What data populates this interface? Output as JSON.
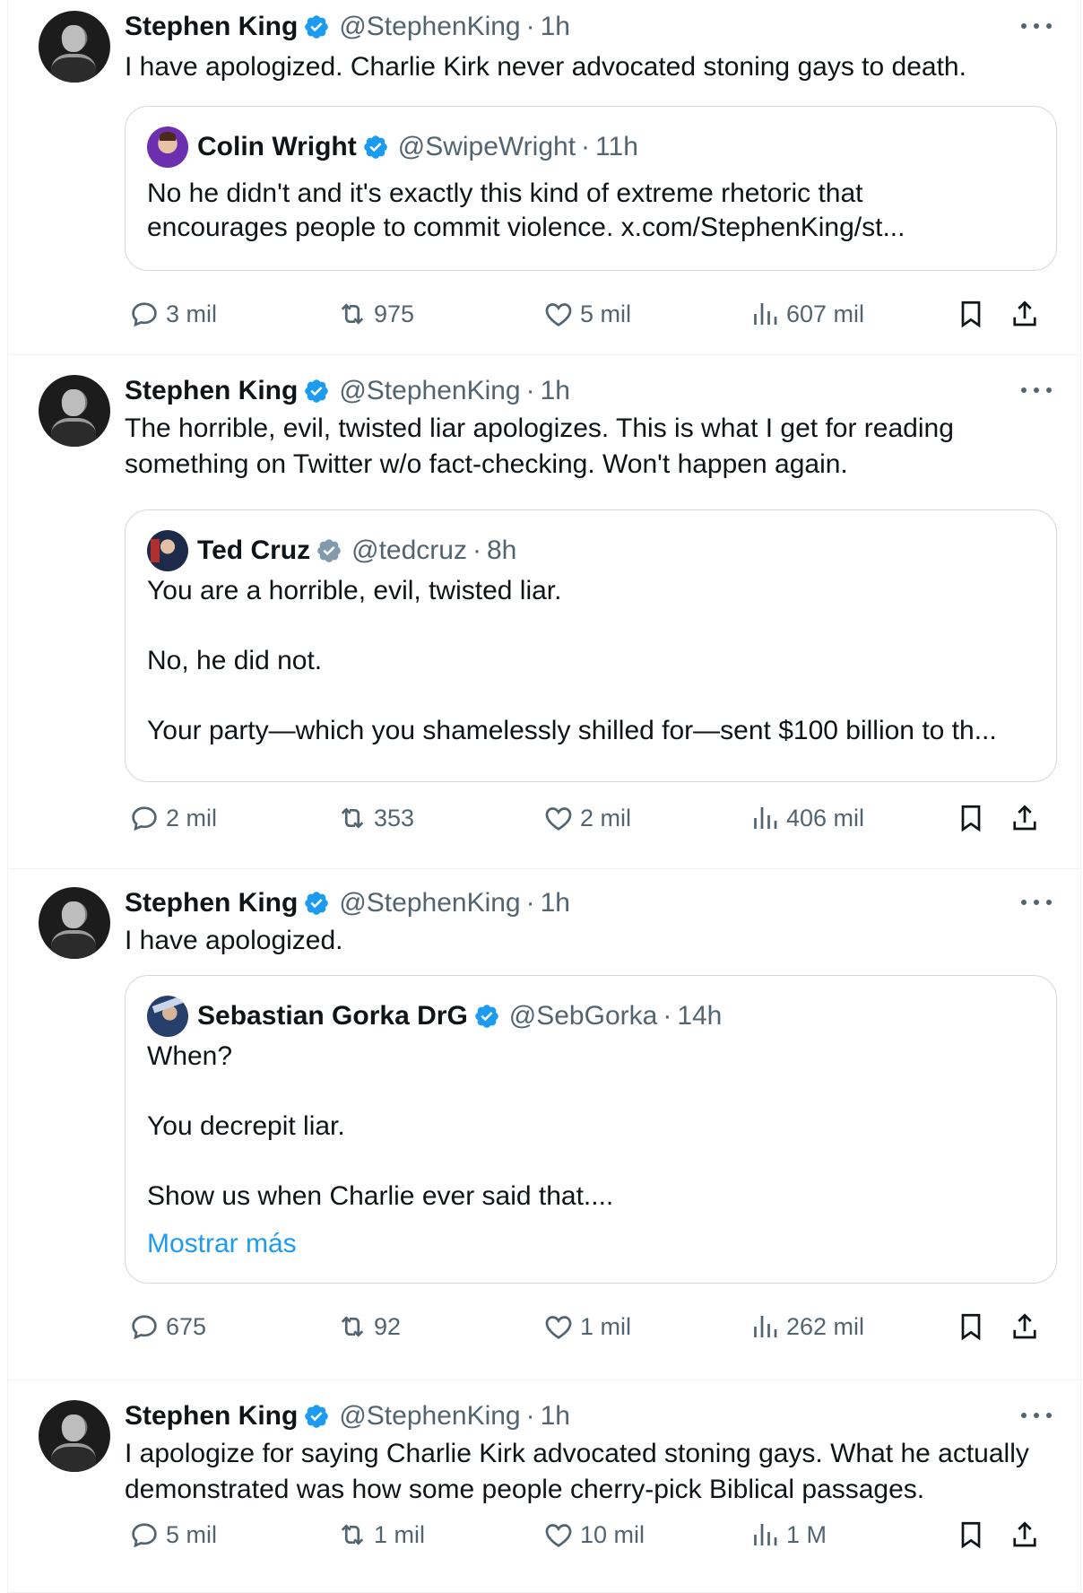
{
  "colors": {
    "verified": "#1d9bf0",
    "link": "#1d9bf0",
    "muted": "#536471",
    "text": "#0f1419"
  },
  "icons": [
    "verified-badge-icon",
    "more-icon",
    "reply-icon",
    "retweet-icon",
    "like-icon",
    "views-icon",
    "bookmark-icon",
    "share-icon"
  ],
  "tweets": [
    {
      "name": "Stephen King",
      "handle": "@StephenKing",
      "dot": "·",
      "time": "1h",
      "text": "I have apologized. Charlie Kirk never advocated stoning gays to death.",
      "quote": {
        "name": "Colin Wright",
        "handle": "@SwipeWright",
        "dot": "·",
        "time": "11h",
        "badge": "blue",
        "text": "No he didn't and it's exactly this kind of extreme rhetoric that\nencourages people to commit violence. x.com/StephenKing/st..."
      },
      "stats": {
        "replies": "3 mil",
        "retweets": "975",
        "likes": "5 mil",
        "views": "607 mil"
      }
    },
    {
      "name": "Stephen King",
      "handle": "@StephenKing",
      "dot": "·",
      "time": "1h",
      "text": "The horrible, evil, twisted liar apologizes. This is what I get for reading\nsomething on Twitter w/o fact-checking. Won't happen again.",
      "quote": {
        "name": "Ted Cruz",
        "handle": "@tedcruz",
        "dot": "·",
        "time": "8h",
        "badge": "grey",
        "text": "You are a horrible, evil, twisted liar.\n\nNo, he did not.\n\nYour party—which you shamelessly shilled for—sent $100 billion to th..."
      },
      "stats": {
        "replies": "2 mil",
        "retweets": "353",
        "likes": "2 mil",
        "views": "406 mil"
      }
    },
    {
      "name": "Stephen King",
      "handle": "@StephenKing",
      "dot": "·",
      "time": "1h",
      "text": "I have apologized.",
      "quote": {
        "name": "Sebastian Gorka DrG",
        "handle": "@SebGorka",
        "dot": "·",
        "time": "14h",
        "badge": "blue",
        "text": "When?\n\nYou decrepit liar.\n\nShow us when Charlie ever said that....",
        "show_more": "Mostrar más"
      },
      "stats": {
        "replies": "675",
        "retweets": "92",
        "likes": "1 mil",
        "views": "262 mil"
      }
    },
    {
      "name": "Stephen King",
      "handle": "@StephenKing",
      "dot": "·",
      "time": "1h",
      "text": "I apologize for saying Charlie Kirk advocated stoning gays. What he actually\ndemonstrated was how some people cherry-pick Biblical passages.",
      "stats": {
        "replies": "5 mil",
        "retweets": "1 mil",
        "likes": "10 mil",
        "views": "1 M"
      }
    }
  ]
}
